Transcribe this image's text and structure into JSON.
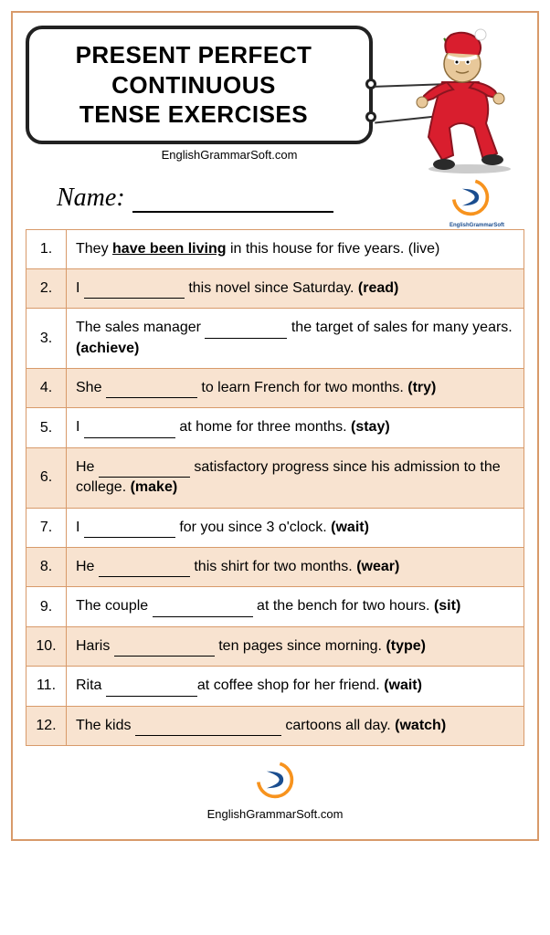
{
  "title": {
    "line1": "PRESENT PERFECT",
    "line2": "CONTINUOUS",
    "line3": "TENSE EXERCISES"
  },
  "website": "EnglishGrammarSoft.com",
  "name_label": "Name:",
  "logo_label": "EnglishGrammarSoft",
  "exercises": [
    {
      "num": "1.",
      "pre": "They ",
      "answer": "have been living",
      "post": " in this house for five years. ",
      "verb": "(live)",
      "blank_width": 0,
      "shaded": false,
      "example": true
    },
    {
      "num": "2.",
      "pre": "I ",
      "post": " this novel since Saturday. ",
      "verb": "(read)",
      "blank_width": 110,
      "shaded": true
    },
    {
      "num": "3.",
      "pre": "The sales manager ",
      "post": " the target of sales for many years. ",
      "verb": "(achieve)",
      "blank_width": 90,
      "shaded": false
    },
    {
      "num": "4.",
      "pre": "She ",
      "post": " to learn French for two months. ",
      "verb": "(try)",
      "blank_width": 100,
      "shaded": true
    },
    {
      "num": "5.",
      "pre": "I ",
      "post": " at home for three months. ",
      "verb": "(stay)",
      "blank_width": 100,
      "shaded": false
    },
    {
      "num": "6.",
      "pre": "He ",
      "post": " satisfactory progress since his admission to the college. ",
      "verb": "(make)",
      "blank_width": 100,
      "shaded": true
    },
    {
      "num": "7.",
      "pre": "I ",
      "post": " for you since 3 o'clock. ",
      "verb": "(wait)",
      "blank_width": 100,
      "shaded": false
    },
    {
      "num": "8.",
      "pre": "He ",
      "post": " this shirt for two months. ",
      "verb": "(wear)",
      "blank_width": 100,
      "shaded": true
    },
    {
      "num": "9.",
      "pre": "The couple ",
      "post": " at the bench for two hours. ",
      "verb": "(sit)",
      "blank_width": 110,
      "shaded": false
    },
    {
      "num": "10.",
      "pre": "Haris ",
      "post": " ten pages since morning. ",
      "verb": "(type)",
      "blank_width": 110,
      "shaded": true
    },
    {
      "num": "11.",
      "pre": "Rita ",
      "post": "at coffee shop for her friend. ",
      "verb": "(wait)",
      "blank_width": 100,
      "shaded": false
    },
    {
      "num": "12.",
      "pre": "The kids ",
      "post": " cartoons all day. ",
      "verb": "(watch)",
      "blank_width": 160,
      "shaded": true
    }
  ],
  "footer_text": "EnglishGrammarSoft.com"
}
